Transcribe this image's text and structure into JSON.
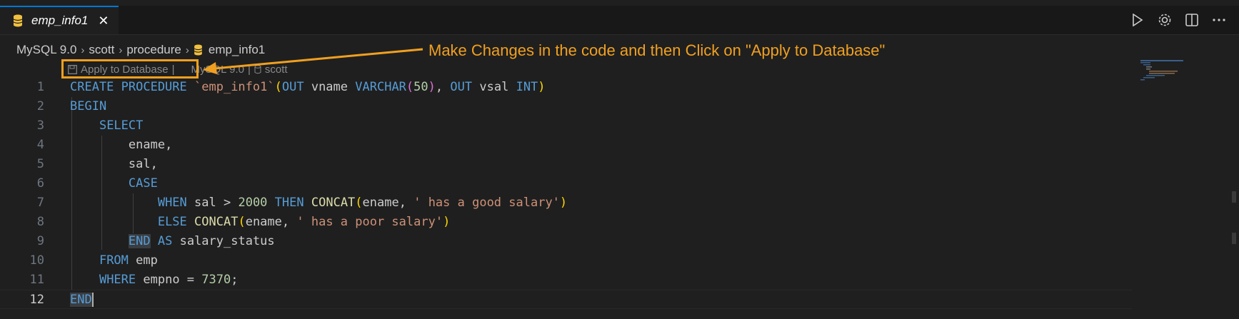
{
  "tab": {
    "title": "emp_info1",
    "close": "✕"
  },
  "breadcrumb": {
    "items": [
      "MySQL 9.0",
      "scott",
      "procedure",
      "emp_info1"
    ],
    "separator": "›"
  },
  "codelens": {
    "apply_label": "Apply to Database",
    "divider": "|",
    "connection": "MySQL 9.0",
    "divider2": "|",
    "schema": "scott"
  },
  "annotation": {
    "text": "Make Changes in the code  and then Click on \"Apply to Database\"",
    "color": "#f0a020"
  },
  "editor": {
    "line_numbers": [
      "1",
      "2",
      "3",
      "4",
      "5",
      "6",
      "7",
      "8",
      "9",
      "10",
      "11",
      "12"
    ],
    "current_line": "12"
  },
  "colors": {
    "keyword": "#569cd6",
    "function": "#dcdcaa",
    "string": "#ce9178",
    "number": "#b5cea8",
    "accent": "#0078d4"
  },
  "icons": [
    "database-icon",
    "close-icon",
    "run-icon",
    "settings-icon",
    "split-editor-icon",
    "more-icon",
    "save-icon"
  ]
}
